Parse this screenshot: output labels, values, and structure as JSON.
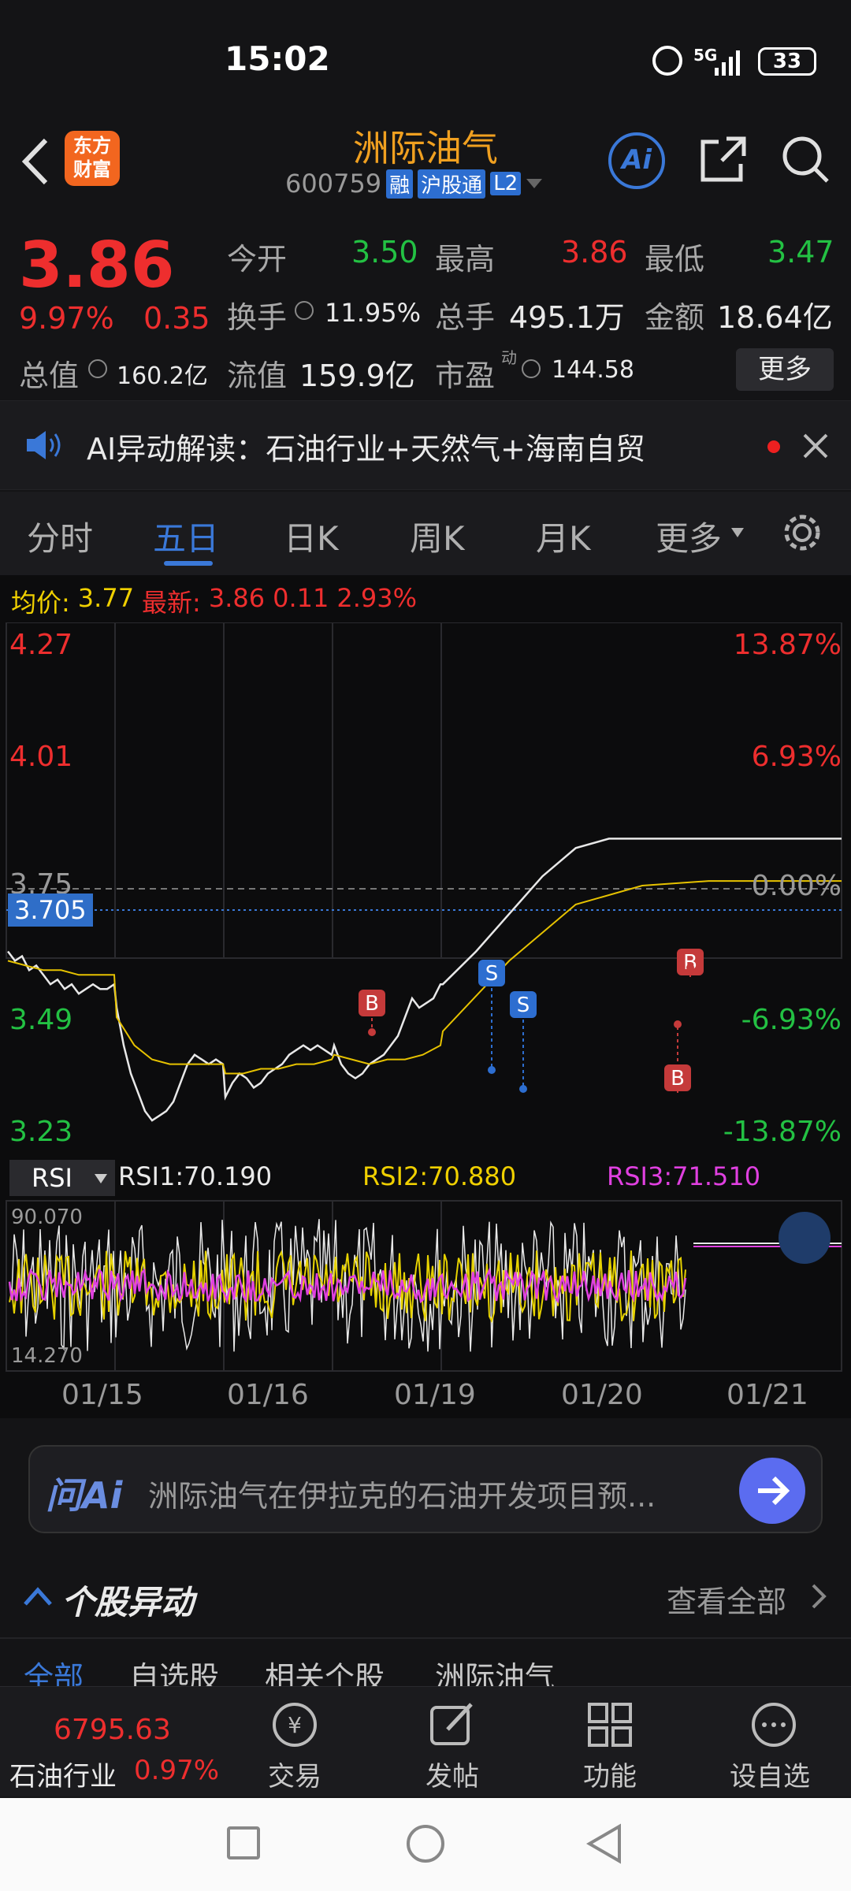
{
  "status_bar": {
    "time": "15:02",
    "network": "5G",
    "battery": "33"
  },
  "header": {
    "title": "洲际油气",
    "code": "600759",
    "tags": [
      "融",
      "沪股通",
      "L2"
    ],
    "ai_label": "Ai"
  },
  "quote": {
    "price": "3.86",
    "change_pct": "9.97%",
    "change": "0.35",
    "open_label": "今开",
    "open": "3.50",
    "high_label": "最高",
    "high": "3.86",
    "low_label": "最低",
    "low": "3.47",
    "turnover_label": "换手",
    "turnover": "11.95%",
    "volume_label": "总手",
    "volume": "495.1万",
    "amount_label": "金额",
    "amount": "18.64亿",
    "mcap_label": "总值",
    "mcap": "160.2亿",
    "float_label": "流值",
    "float": "159.9亿",
    "pe_label": "市盈",
    "pe_sup": "动",
    "pe": "144.58",
    "more": "更多"
  },
  "ai_bar": {
    "text": "AI异动解读：石油行业+天然气+海南自贸"
  },
  "tabs": [
    "分时",
    "五日",
    "日K",
    "周K",
    "月K",
    "更多"
  ],
  "active_tab": "五日",
  "info_line": {
    "avg_label": "均价:",
    "avg": "3.77",
    "latest_label": "最新:",
    "latest": "3.86",
    "chg": "0.11",
    "pct": "2.93%"
  },
  "chart_data": {
    "type": "line",
    "y_left": [
      "4.27",
      "4.01",
      "3.75",
      "3.49",
      "3.23"
    ],
    "y_right": [
      "13.87%",
      "6.93%",
      "0.00%",
      "-6.93%",
      "-13.87%"
    ],
    "crosshair_label": "3.705",
    "x_labels": [
      "01/15",
      "01/16",
      "01/19",
      "01/20",
      "01/21"
    ],
    "ylim": [
      3.23,
      4.27
    ],
    "signals": [
      "B",
      "S",
      "S",
      "B",
      "B"
    ],
    "rsi": {
      "selector": "RSI",
      "rsi1": "RSI1:70.190",
      "rsi2": "RSI2:70.880",
      "rsi3": "RSI3:71.510",
      "top": "90.070",
      "bottom": "14.270"
    }
  },
  "ask": {
    "logo": "问Ai",
    "text": "洲际油气在伊拉克的石油开发项目预..."
  },
  "movement": {
    "title": "个股异动",
    "view_all": "查看全部",
    "subtabs": [
      "全部",
      "自选股",
      "相关个股",
      "洲际油气"
    ]
  },
  "bottom_nav": {
    "index_value": "6795.63",
    "index_name": "石油行业",
    "index_pct": "0.97%",
    "items": [
      "交易",
      "发帖",
      "功能",
      "设自选"
    ]
  },
  "colors": {
    "up": "#ee2e2e",
    "down": "#23c143",
    "accent": "#3a78d8",
    "brand": "#f0a020"
  }
}
